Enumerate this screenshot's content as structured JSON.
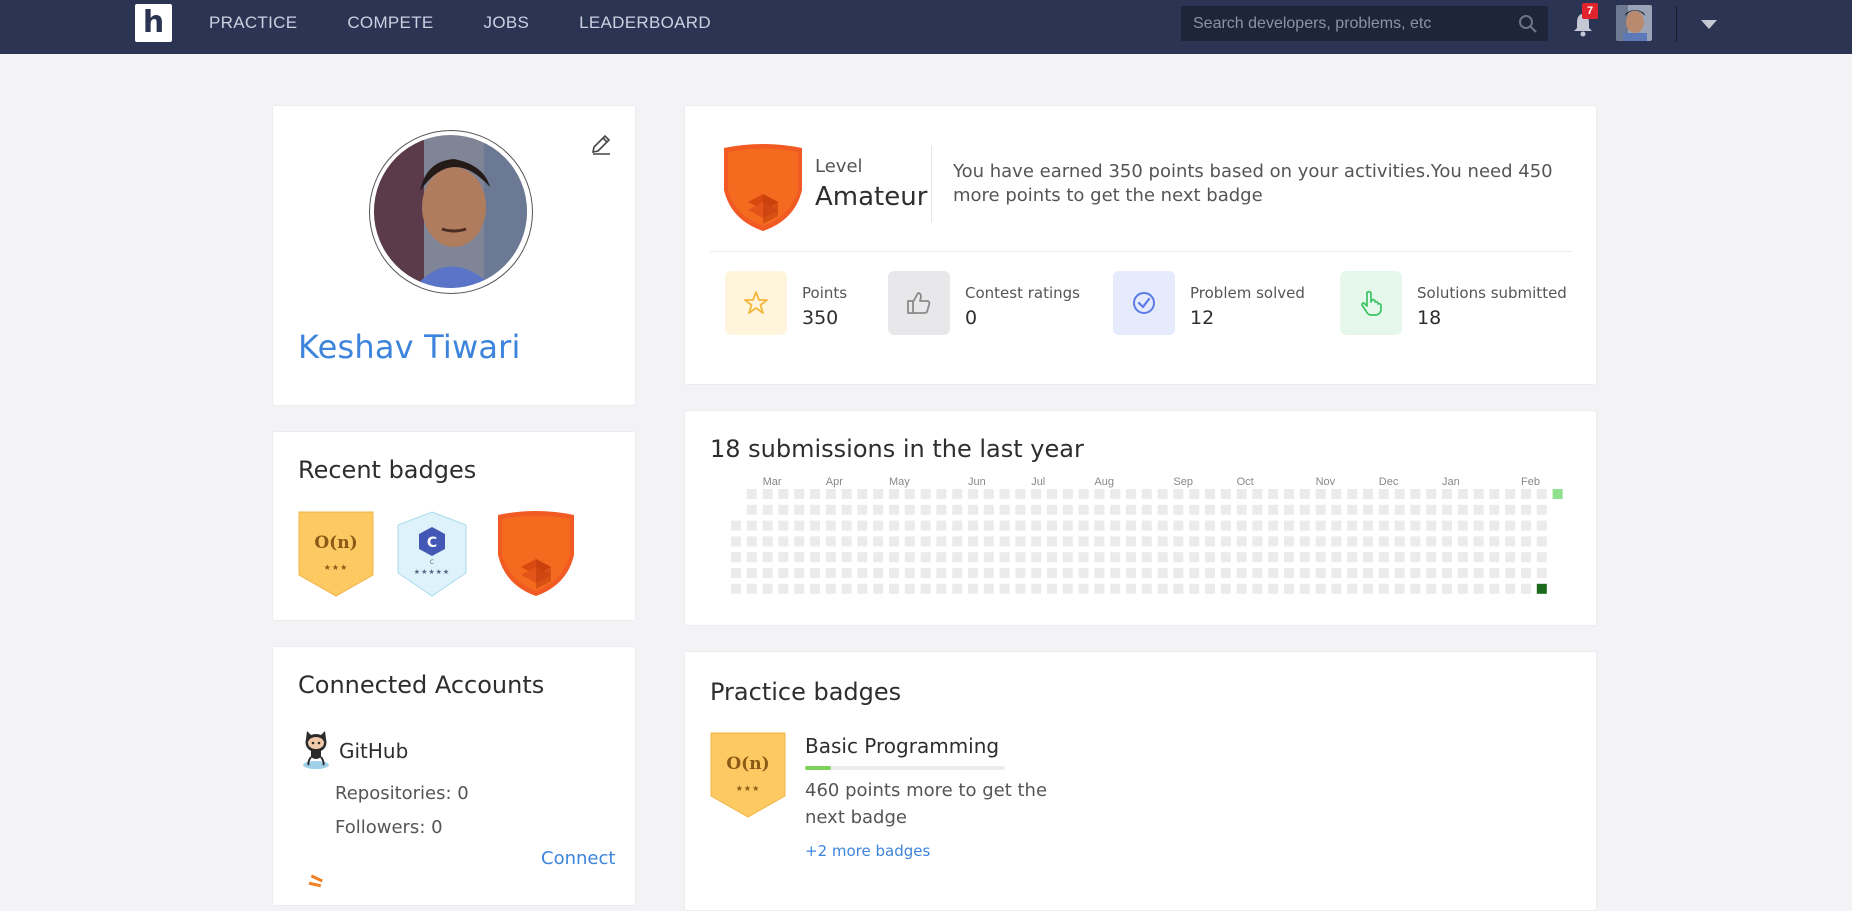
{
  "nav": {
    "logo_letter": "h",
    "links": [
      "PRACTICE",
      "COMPETE",
      "JOBS",
      "LEADERBOARD"
    ],
    "search_placeholder": "Search developers, problems, etc",
    "notification_count": "7"
  },
  "profile": {
    "name": "Keshav Tiwari"
  },
  "recent_badges": {
    "title": "Recent badges",
    "badges": [
      {
        "icon": "complexity-badge-icon",
        "text": "O(n)",
        "stars": "★★★",
        "color": "#fcc963"
      },
      {
        "icon": "c-language-badge-icon",
        "text": "C",
        "small": "C",
        "stars": "★★★★★",
        "color": "#ddf2fb"
      },
      {
        "icon": "amateur-shield-icon",
        "color": "#f15a22"
      }
    ]
  },
  "connected_accounts": {
    "title": "Connected Accounts",
    "github": {
      "name": "GitHub",
      "repositories": "Repositories: 0",
      "followers": "Followers: 0",
      "connect": "Connect"
    }
  },
  "level": {
    "label": "Level",
    "value": "Amateur",
    "description": "You have earned 350 points based on your activities.You need 450 more points to get the next badge",
    "stats": [
      {
        "label": "Points",
        "value": "350",
        "icon": "star-icon",
        "tile_color": "#fff4dc",
        "icon_color": "#f5b73b"
      },
      {
        "label": "Contest ratings",
        "value": "0",
        "icon": "thumbs-up-icon",
        "tile_color": "#e8e8ea",
        "icon_color": "#8a8a8a"
      },
      {
        "label": "Problem solved",
        "value": "12",
        "icon": "check-circle-icon",
        "tile_color": "#e5eafc",
        "icon_color": "#5a7be8"
      },
      {
        "label": "Solutions submitted",
        "value": "18",
        "icon": "pointer-hand-icon",
        "tile_color": "#e6f8ec",
        "icon_color": "#3cc363"
      }
    ]
  },
  "submissions": {
    "title": "18 submissions in the last year",
    "months": [
      "Mar",
      "Apr",
      "May",
      "Jun",
      "Jul",
      "Aug",
      "Sep",
      "Oct",
      "Nov",
      "Dec",
      "Jan",
      "Feb"
    ],
    "active_cells": [
      {
        "week": 52,
        "day": 0,
        "level": "light"
      },
      {
        "week": 51,
        "day": 6,
        "level": "dark"
      }
    ],
    "colors": {
      "empty": "#ebebeb",
      "light": "#8fe08a",
      "dark": "#1c6b1c"
    }
  },
  "practice": {
    "title": "Practice badges",
    "badge": {
      "name": "Basic Programming",
      "text": "O(n)",
      "stars": "★★★",
      "progress": 0.13,
      "note": "460 points more to get the next badge",
      "more": "+2 more badges"
    }
  }
}
